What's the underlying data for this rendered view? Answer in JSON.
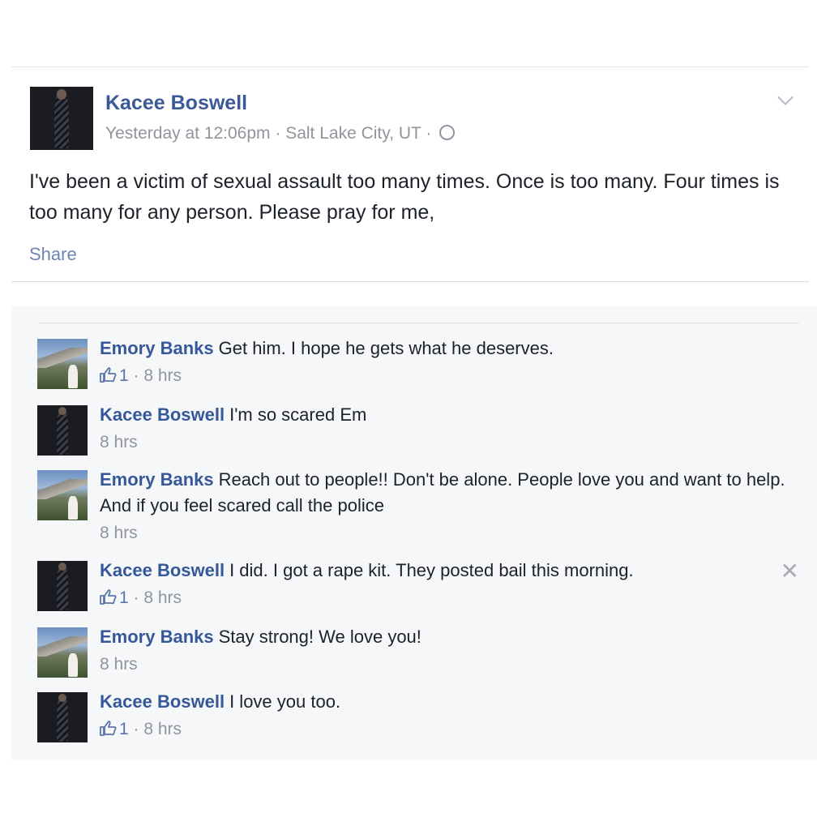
{
  "post": {
    "author": "Kacee Boswell",
    "timestamp": "Yesterday at 12:06pm",
    "location": "Salt Lake City, UT",
    "separator": " · ",
    "text": "I've been a victim of sexual assault too many times. Once is too many. Four times is too many for any person. Please pray for me,",
    "share_label": "Share"
  },
  "comments": [
    {
      "author": "Emory Banks",
      "text": "Get him. I hope he gets what he deserves.",
      "likes": "1",
      "time": "8 hrs"
    },
    {
      "author": "Kacee Boswell",
      "text": "I'm so scared Em",
      "likes": "",
      "time": "8 hrs"
    },
    {
      "author": "Emory Banks",
      "text": "Reach out to people!! Don't be alone. People love you and want to help. And if you feel scared call the police",
      "likes": "",
      "time": "8 hrs"
    },
    {
      "author": "Kacee Boswell",
      "text": "I did. I got a rape kit. They posted bail this morning.",
      "likes": "1",
      "time": "8 hrs"
    },
    {
      "author": "Emory Banks",
      "text": "Stay strong! We love you!",
      "likes": "",
      "time": "8 hrs"
    },
    {
      "author": "Kacee Boswell",
      "text": "I love you too.",
      "likes": "1",
      "time": "8 hrs"
    }
  ],
  "meta_separator": " · ",
  "icons": {
    "like": "thumbs-up-icon",
    "privacy": "globe-icon",
    "menu": "chevron-down-icon",
    "dismiss": "close-icon"
  },
  "colors": {
    "link": "#365899",
    "meta": "#90949c",
    "comments_bg": "#f6f7f9"
  }
}
